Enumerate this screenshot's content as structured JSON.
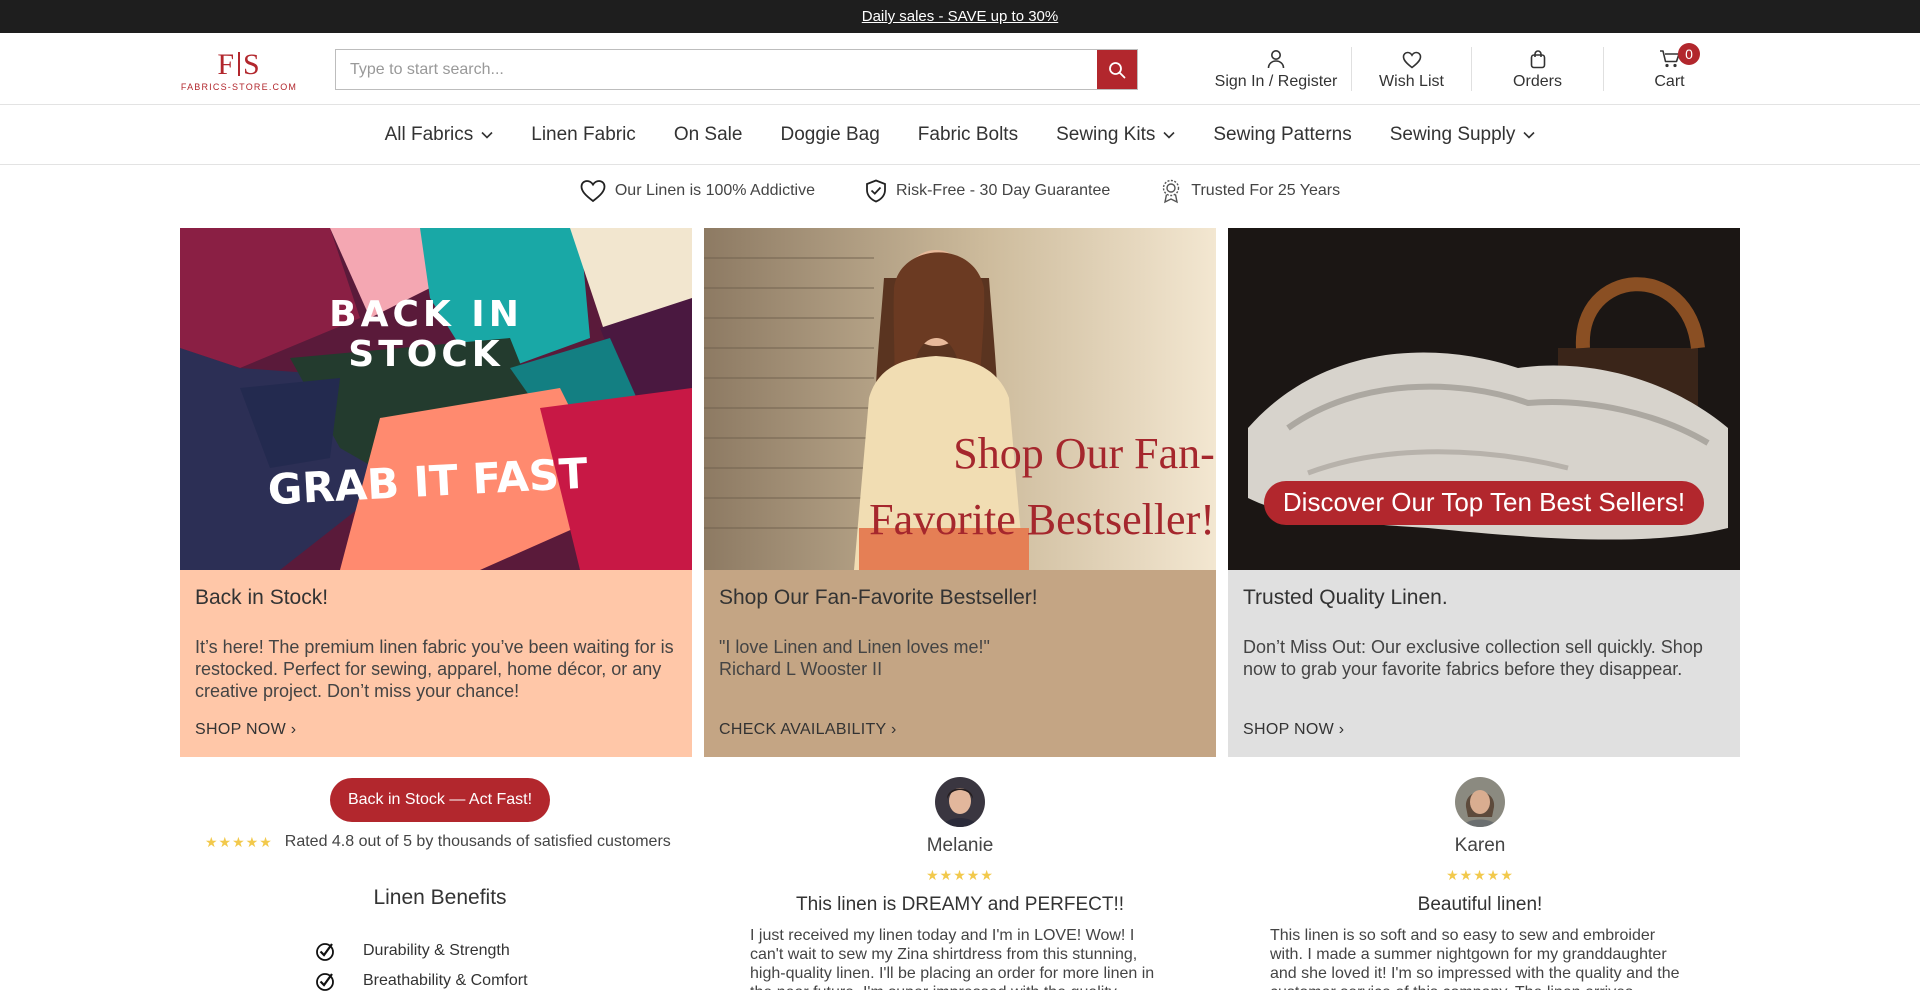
{
  "announcement": {
    "text": "Daily sales - SAVE up to 30%"
  },
  "logo": {
    "mark_left": "F",
    "mark_right": "S",
    "text": "FABRICS-STORE.COM"
  },
  "search": {
    "placeholder": "Type to start search..."
  },
  "header_actions": {
    "signin": "Sign In / Register",
    "wishlist": "Wish List",
    "orders": "Orders",
    "cart": "Cart",
    "cart_count": "0"
  },
  "nav": [
    {
      "label": "All Fabrics",
      "dropdown": true
    },
    {
      "label": "Linen Fabric",
      "dropdown": false
    },
    {
      "label": "On Sale",
      "dropdown": false
    },
    {
      "label": "Doggie Bag",
      "dropdown": false
    },
    {
      "label": "Fabric Bolts",
      "dropdown": false
    },
    {
      "label": "Sewing Kits",
      "dropdown": true
    },
    {
      "label": "Sewing Patterns",
      "dropdown": false
    },
    {
      "label": "Sewing Supply",
      "dropdown": true
    }
  ],
  "trust": [
    {
      "icon": "heart-icon",
      "label": "Our Linen is 100% Addictive"
    },
    {
      "icon": "shield-check-icon",
      "label": "Risk-Free - 30 Day Guarantee"
    },
    {
      "icon": "badge-icon",
      "label": "Trusted For 25 Years"
    }
  ],
  "cards": [
    {
      "img_line1": "BACK IN",
      "img_line2": "STOCK",
      "img_line3": "GRAB IT FAST",
      "title": "Back in Stock!",
      "text": "It’s here! The premium linen fabric you’ve been waiting for is restocked. Perfect for sewing, apparel, home décor, or any creative project. Don’t miss your chance!",
      "cta": "SHOP NOW ›",
      "bg": "#ffc7a8"
    },
    {
      "img_line1": "Shop Our Fan-",
      "img_line2": "Favorite Bestseller!",
      "title": "Shop Our Fan-Favorite Bestseller!",
      "quote": "\"I love Linen and Linen loves me!\"",
      "author": "Richard L Wooster II",
      "cta": "CHECK AVAILABILITY ›",
      "bg": "#c4a584"
    },
    {
      "img_pill": "Discover Our Top Ten Best Sellers!",
      "title": "Trusted Quality Linen.",
      "text": "Don’t Miss Out: Our exclusive collection sell quickly. Shop now to grab your favorite fabrics before they disappear.",
      "cta": "SHOP NOW ›",
      "bg": "#e0e0e0"
    }
  ],
  "promo": {
    "button": "Back in Stock — Act Fast!"
  },
  "rating": {
    "stars": "★★★★★",
    "text": "Rated 4.8 out of 5 by thousands of satisfied customers"
  },
  "benefits": {
    "title": "Linen Benefits",
    "items": [
      "Durability & Strength",
      "Breathability & Comfort"
    ]
  },
  "reviews": [
    {
      "name": "Melanie",
      "stars": "★★★★★",
      "title": "This linen is DREAMY and PERFECT!!",
      "text": "I just received my linen today and I'm in LOVE! Wow! I can't wait to sew my Zina shirtdress from this stunning, high-quality linen. I'll be placing an order for more linen in the near future. I'm super impressed with the quality"
    },
    {
      "name": "Karen",
      "stars": "★★★★★",
      "title": "Beautiful linen!",
      "text": "This linen is so soft and so easy to sew and embroider with. I made a summer nightgown for my granddaughter and she loved it! I'm so impressed with the quality and the customer service of this company. The linen arrives"
    }
  ],
  "colors": {
    "brand": "#b2272d",
    "topbar": "#1e1e1e",
    "star": "#f2c94c"
  }
}
